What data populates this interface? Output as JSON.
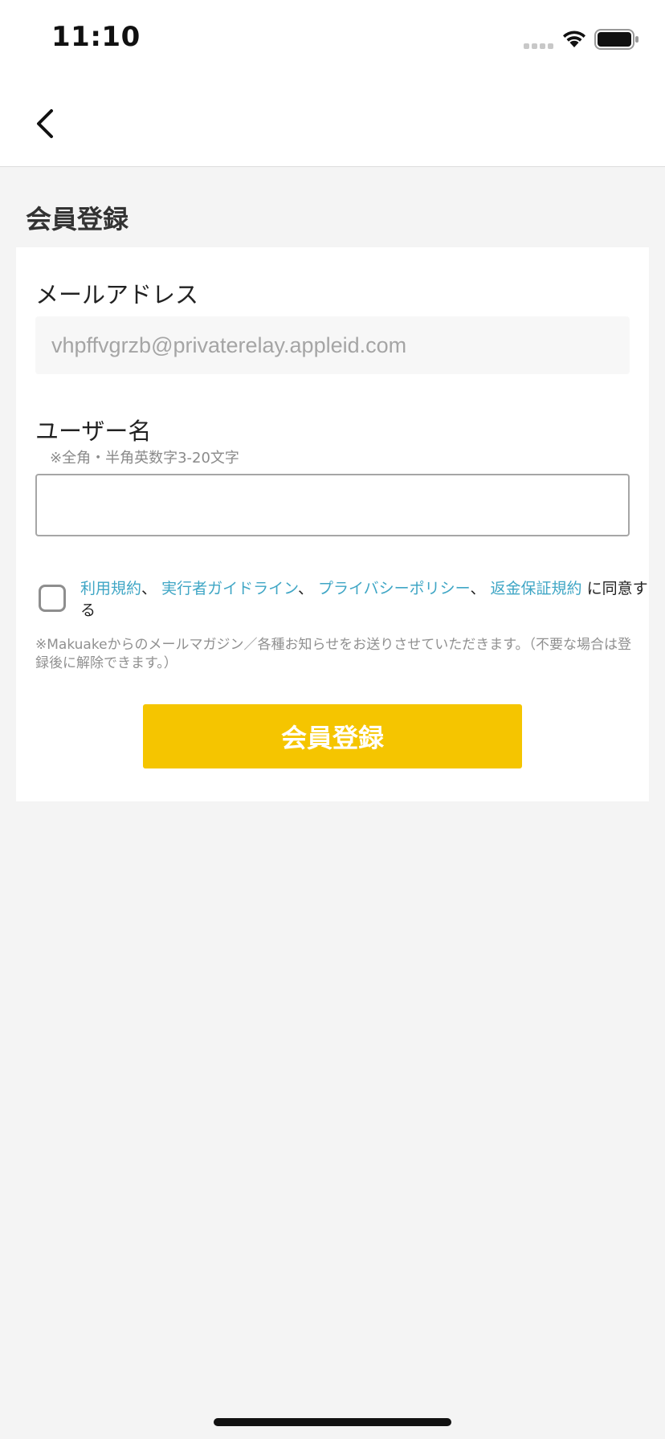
{
  "status_bar": {
    "time": "11:10",
    "signal_icon": "cellular-signal-icon",
    "wifi_icon": "wifi-icon",
    "battery_icon": "battery-icon"
  },
  "nav": {
    "back_icon": "chevron-left-icon"
  },
  "page": {
    "title": "会員登録"
  },
  "form": {
    "email_label": "メールアドレス",
    "email_value": "vhpffvgrzb@privaterelay.appleid.com",
    "username_label": "ユーザー名",
    "username_hint": "※全角・半角英数字3-20文字",
    "username_value": "",
    "agreement": {
      "link_terms": "利用規約",
      "sep": "、",
      "link_guidelines": "実行者ガイドライン",
      "link_privacy": "プライバシーポリシー",
      "link_refund": "返金保証規約",
      "suffix": "に同意する",
      "checked": false
    },
    "notice": "※Makuakeからのメールマガジン／各種お知らせをお送りさせていただきます。（不要な場合は登録後に解除できます。）",
    "submit_label": "会員登録"
  },
  "colors": {
    "accent": "#f5c500",
    "link": "#3fa6c5",
    "background": "#f4f4f4"
  }
}
